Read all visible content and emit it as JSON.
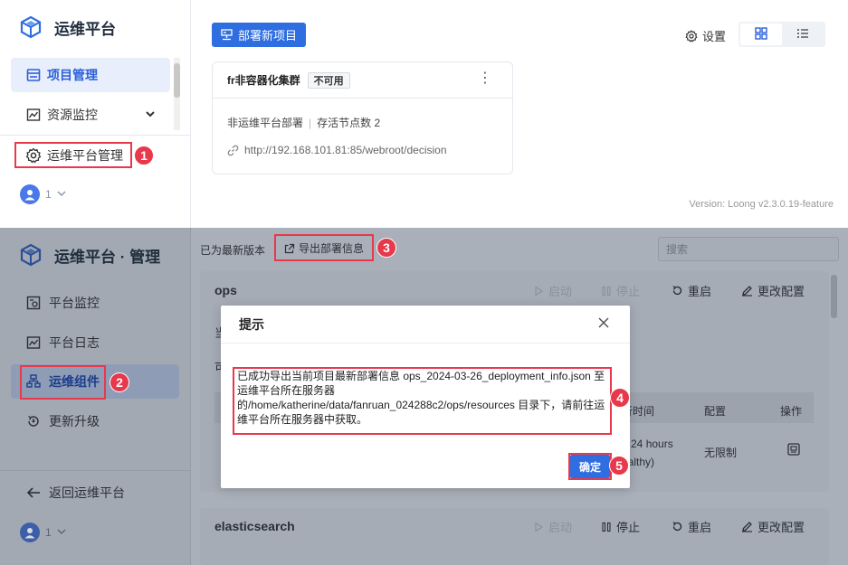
{
  "top": {
    "brand_title": "运维平台",
    "nav": [
      {
        "label": "项目管理"
      },
      {
        "label": "资源监控"
      },
      {
        "label": "运维平台管理"
      }
    ],
    "user_count": "1",
    "new_project_label": "部署新项目",
    "settings_label": "设置",
    "card": {
      "title": "fr非容器化集群",
      "tag": "不可用",
      "deploy_type": "非运维平台部署",
      "alive_nodes": "存活节点数 2",
      "url": "http://192.168.101.81:85/webroot/decision"
    },
    "version": "Version: Loong v2.3.0.19-feature"
  },
  "bottom": {
    "brand_title": "运维平台 · 管理",
    "nav": [
      {
        "label": "平台监控"
      },
      {
        "label": "平台日志"
      },
      {
        "label": "运维组件"
      },
      {
        "label": "更新升级"
      }
    ],
    "back_label": "返回运维平台",
    "user_count": "1",
    "status_text": "已为最新版本",
    "export_label": "导出部署信息",
    "search_placeholder": "搜索",
    "panels": [
      {
        "title": "ops",
        "actions": {
          "start": "启动",
          "stop": "停止",
          "restart": "重启",
          "config": "更改配置"
        },
        "row_label_1": "当",
        "row_label_2": "可",
        "headers": {
          "runtime": "行时间",
          "config": "配置",
          "op": "操作"
        },
        "row": {
          "runtime_line1": "p 24 hours",
          "runtime_line2": "ealthy)",
          "config": "无限制"
        }
      },
      {
        "title": "elasticsearch",
        "actions": {
          "start": "启动",
          "stop": "停止",
          "restart": "重启",
          "config": "更改配置"
        }
      }
    ]
  },
  "modal": {
    "title": "提示",
    "message": "已成功导出当前项目最新部署信息 ops_2024-03-26_deployment_info.json 至运维平台所在服务器的/home/katherine/data/fanruan_024288c2/ops/resources 目录下，请前往运维平台所在服务器中获取。",
    "ok_label": "确定"
  },
  "annotations": [
    "1",
    "2",
    "3",
    "4",
    "5"
  ],
  "colors": {
    "primary": "#2f6ee0",
    "highlight": "#e8384b",
    "overlay": "#aab0ba"
  }
}
